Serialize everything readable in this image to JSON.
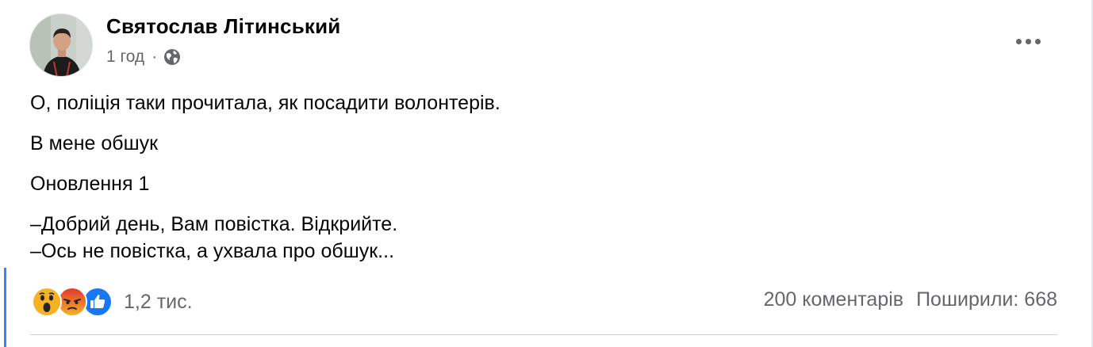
{
  "post": {
    "author": "Святослав Літинський",
    "time": "1 год",
    "separator": "·",
    "privacy_icon": "globe-icon",
    "more_icon": "ellipsis-icon",
    "paragraphs": [
      "О, поліція таки прочитала, як посадити волонтерів.",
      "В мене обшук",
      "Оновлення 1"
    ],
    "dialog_lines": [
      "–Добрий день, Вам повістка. Відкрийте.",
      "–Ось не повістка, а ухвала про обшук..."
    ]
  },
  "footer": {
    "reaction_icons": [
      "wow-reaction-icon",
      "angry-reaction-icon",
      "like-reaction-icon"
    ],
    "reaction_count": "1,2 тис.",
    "comments": "200 коментарів",
    "shares": "Поширили: 668"
  },
  "colors": {
    "text": "#050505",
    "secondary": "#65676b",
    "accent": "#2d88ff",
    "like": "#1877f2",
    "wow": "#f7b125",
    "angry": "#e9710f"
  }
}
